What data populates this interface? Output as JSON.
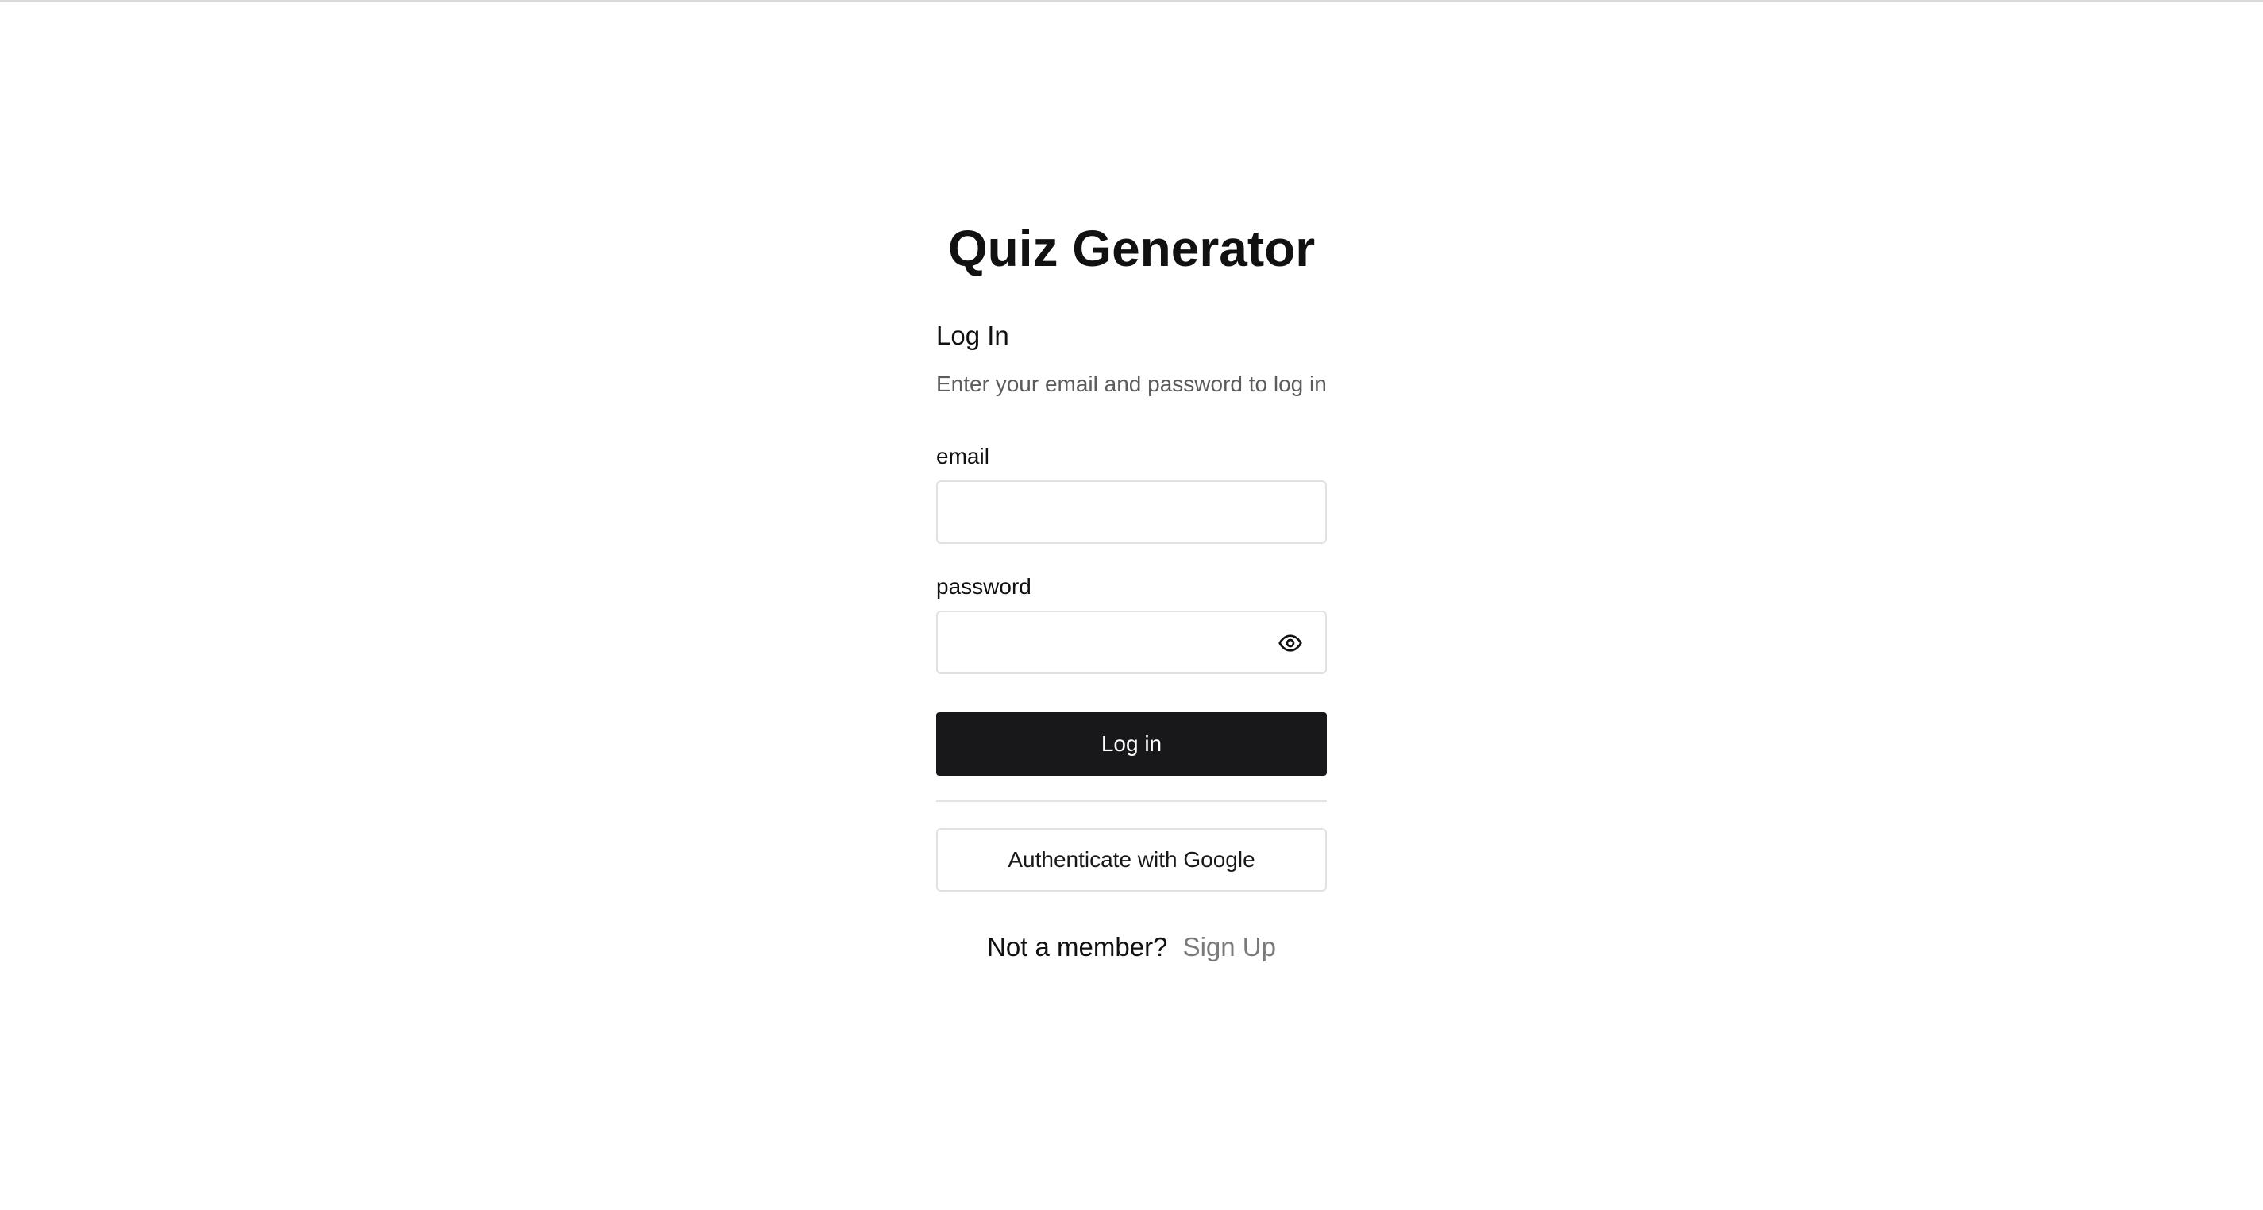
{
  "app": {
    "title": "Quiz Generator"
  },
  "login_form": {
    "heading": "Log In",
    "subtitle": "Enter your email and password to log in",
    "email": {
      "label": "email",
      "value": "",
      "placeholder": ""
    },
    "password": {
      "label": "password",
      "value": "",
      "placeholder": "",
      "toggle_icon": "eye-icon"
    },
    "submit_label": "Log in",
    "google_label": "Authenticate with Google"
  },
  "signup": {
    "prompt": "Not a member?",
    "link_label": "Sign Up"
  },
  "colors": {
    "primary_button_bg": "#18181b",
    "primary_button_text": "#ffffff",
    "muted_text": "#5c5c5c",
    "link_text": "#7a7a7a",
    "border": "#e1e1e1"
  }
}
